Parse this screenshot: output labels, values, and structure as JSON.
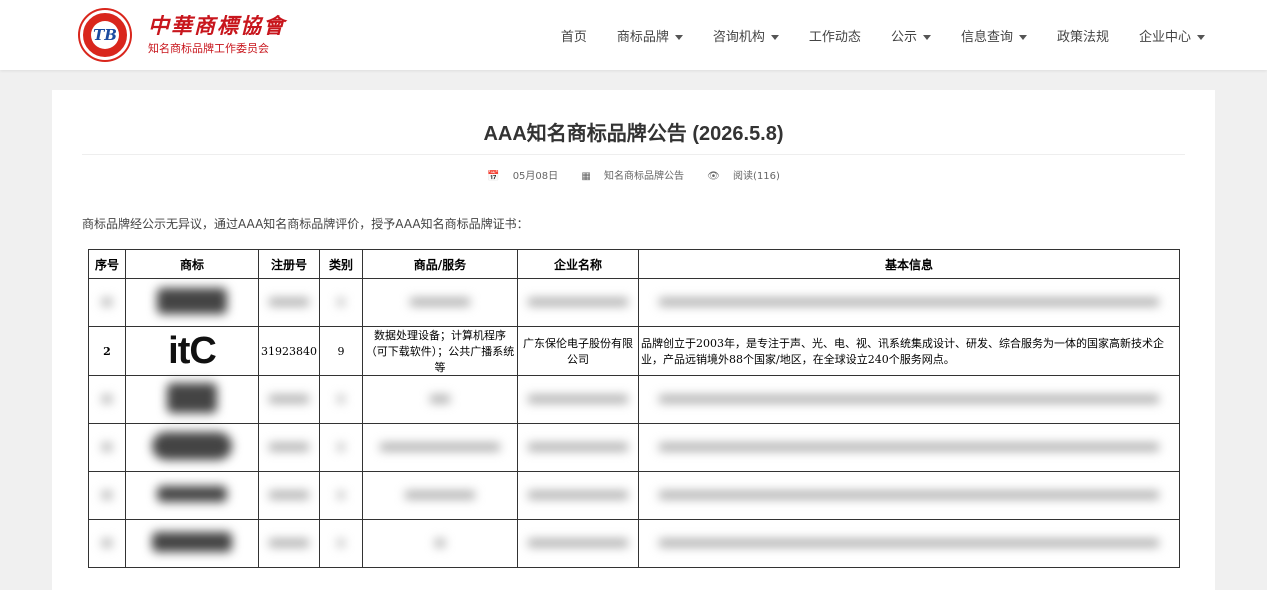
{
  "header": {
    "logo_badge": "TB",
    "logo_cn": "中華商標協會",
    "logo_sub": "知名商标品牌工作委员会",
    "nav": [
      {
        "label": "首页",
        "dropdown": false
      },
      {
        "label": "商标品牌",
        "dropdown": true
      },
      {
        "label": "咨询机构",
        "dropdown": true
      },
      {
        "label": "工作动态",
        "dropdown": false
      },
      {
        "label": "公示",
        "dropdown": true
      },
      {
        "label": "信息查询",
        "dropdown": true
      },
      {
        "label": "政策法规",
        "dropdown": false
      },
      {
        "label": "企业中心",
        "dropdown": true
      }
    ]
  },
  "article": {
    "title": "AAA知名商标品牌公告 (2026.5.8)",
    "date": "05月08日",
    "category": "知名商标品牌公告",
    "reads": "阅读(116)",
    "intro": "商标品牌经公示无异议，通过AAA知名商标品牌评价，授予AAA知名商标品牌证书："
  },
  "table": {
    "headers": [
      "序号",
      "商标",
      "注册号",
      "类别",
      "商品/服务",
      "企业名称",
      "基本信息"
    ],
    "featured_row": {
      "no": "2",
      "logo_text": "itC",
      "reg_no": "31923840",
      "class": "9",
      "goods": "数据处理设备；计算机程序（可下载软件）；公共广播系统等",
      "company": "广东保伦电子股份有限公司",
      "info": "品牌创立于2003年，是专注于声、光、电、视、讯系统集成设计、研发、综合服务为一体的国家高新技术企业，产品远销境外88个国家/地区，在全球设立240个服务网点。"
    }
  },
  "colors": {
    "brand_red": "#c8161d",
    "logo_blue": "#1a4aa0"
  }
}
